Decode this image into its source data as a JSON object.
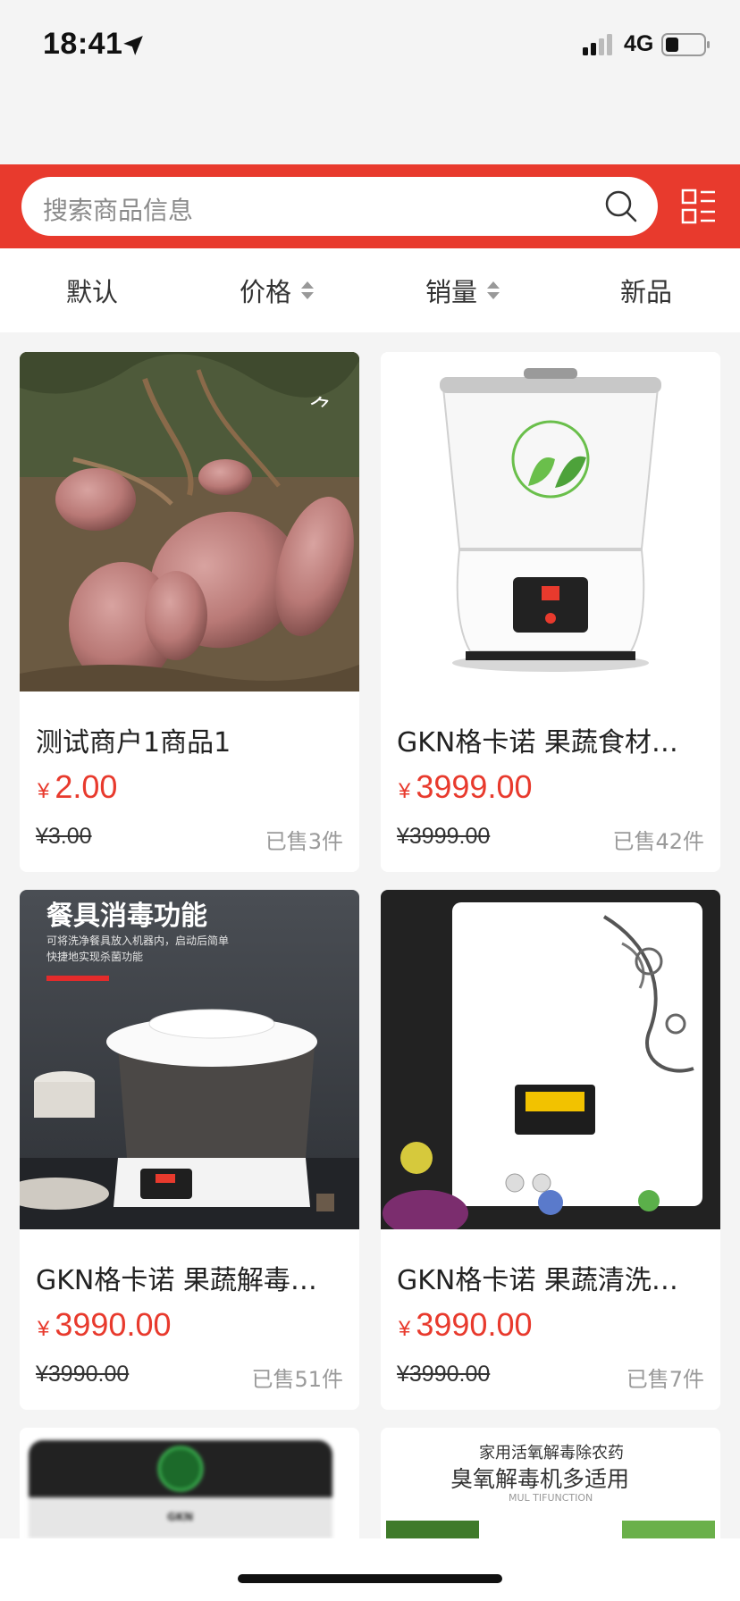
{
  "status_bar": {
    "time": "18:41",
    "network": "4G"
  },
  "search": {
    "placeholder": "搜索商品信息"
  },
  "sort_tabs": [
    {
      "label": "默认"
    },
    {
      "label": "价格"
    },
    {
      "label": "销量"
    },
    {
      "label": "新品"
    }
  ],
  "products": [
    {
      "title": "测试商户1商品1",
      "currency": "¥",
      "price": "2.00",
      "original_price": "¥3.00",
      "sold": "已售3件"
    },
    {
      "title": "GKN格卡诺 果蔬食材…",
      "currency": "¥",
      "price": "3999.00",
      "original_price": "¥3999.00",
      "sold": "已售42件"
    },
    {
      "title": "GKN格卡诺 果蔬解毒…",
      "currency": "¥",
      "price": "3990.00",
      "original_price": "¥3990.00",
      "sold": "已售51件",
      "image_heading": "餐具消毒功能",
      "image_caption_1": "可将洗净餐具放入机器内，启动后简单",
      "image_caption_2": "快捷地实现杀菌功能"
    },
    {
      "title": "GKN格卡诺 果蔬清洗…",
      "currency": "¥",
      "price": "3990.00",
      "original_price": "¥3990.00",
      "sold": "已售7件"
    }
  ],
  "partial_products": [
    {
      "image_text": "GKN"
    },
    {
      "image_line_1": "家用活氧解毒除农药",
      "image_line_2": "臭氧解毒机多适用",
      "image_line_3": "MUL TIFUNCTION"
    }
  ],
  "colors": {
    "accent": "#e83a2d",
    "background": "#f4f4f4"
  }
}
